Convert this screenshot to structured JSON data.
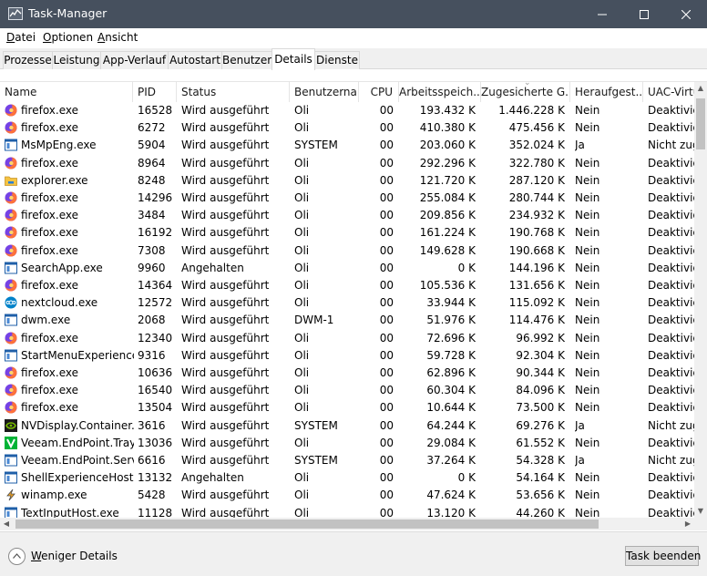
{
  "window": {
    "title": "Task-Manager"
  },
  "menu": [
    "Datei",
    "Optionen",
    "Ansicht"
  ],
  "tabs": [
    {
      "label": "Prozesse",
      "active": false
    },
    {
      "label": "Leistung",
      "active": false
    },
    {
      "label": "App-Verlauf",
      "active": false
    },
    {
      "label": "Autostart",
      "active": false
    },
    {
      "label": "Benutzer",
      "active": false
    },
    {
      "label": "Details",
      "active": true
    },
    {
      "label": "Dienste",
      "active": false
    }
  ],
  "columns": [
    "Name",
    "PID",
    "Status",
    "Benutzerna...",
    "CPU",
    "Arbeitsspeich...",
    "Zugesicherte G...",
    "Heraufgest...",
    "UAC-Virtu"
  ],
  "sorted_column": "Zugesicherte G...",
  "sort_direction": "descending",
  "processes": [
    {
      "icon": "firefox-icon",
      "name": "firefox.exe",
      "pid": "16528",
      "status": "Wird ausgeführt",
      "user": "Oli",
      "cpu": "00",
      "memory": "193.432 K",
      "commit": "1.446.228 K",
      "elevated": "Nein",
      "uac": "Deaktivie"
    },
    {
      "icon": "firefox-icon",
      "name": "firefox.exe",
      "pid": "6272",
      "status": "Wird ausgeführt",
      "user": "Oli",
      "cpu": "00",
      "memory": "410.380 K",
      "commit": "475.456 K",
      "elevated": "Nein",
      "uac": "Deaktivie"
    },
    {
      "icon": "window-app-icon",
      "name": "MsMpEng.exe",
      "pid": "5904",
      "status": "Wird ausgeführt",
      "user": "SYSTEM",
      "cpu": "00",
      "memory": "203.060 K",
      "commit": "352.024 K",
      "elevated": "Ja",
      "uac": "Nicht zug"
    },
    {
      "icon": "firefox-icon",
      "name": "firefox.exe",
      "pid": "8964",
      "status": "Wird ausgeführt",
      "user": "Oli",
      "cpu": "00",
      "memory": "292.296 K",
      "commit": "322.780 K",
      "elevated": "Nein",
      "uac": "Deaktivie"
    },
    {
      "icon": "folder-icon",
      "name": "explorer.exe",
      "pid": "8248",
      "status": "Wird ausgeführt",
      "user": "Oli",
      "cpu": "00",
      "memory": "121.720 K",
      "commit": "287.120 K",
      "elevated": "Nein",
      "uac": "Deaktivie"
    },
    {
      "icon": "firefox-icon",
      "name": "firefox.exe",
      "pid": "14296",
      "status": "Wird ausgeführt",
      "user": "Oli",
      "cpu": "00",
      "memory": "255.084 K",
      "commit": "280.744 K",
      "elevated": "Nein",
      "uac": "Deaktivie"
    },
    {
      "icon": "firefox-icon",
      "name": "firefox.exe",
      "pid": "3484",
      "status": "Wird ausgeführt",
      "user": "Oli",
      "cpu": "00",
      "memory": "209.856 K",
      "commit": "234.932 K",
      "elevated": "Nein",
      "uac": "Deaktivie"
    },
    {
      "icon": "firefox-icon",
      "name": "firefox.exe",
      "pid": "16192",
      "status": "Wird ausgeführt",
      "user": "Oli",
      "cpu": "00",
      "memory": "161.224 K",
      "commit": "190.768 K",
      "elevated": "Nein",
      "uac": "Deaktivie"
    },
    {
      "icon": "firefox-icon",
      "name": "firefox.exe",
      "pid": "7308",
      "status": "Wird ausgeführt",
      "user": "Oli",
      "cpu": "00",
      "memory": "149.628 K",
      "commit": "190.668 K",
      "elevated": "Nein",
      "uac": "Deaktivie"
    },
    {
      "icon": "window-app-icon",
      "name": "SearchApp.exe",
      "pid": "9960",
      "status": "Angehalten",
      "user": "Oli",
      "cpu": "00",
      "memory": "0 K",
      "commit": "144.196 K",
      "elevated": "Nein",
      "uac": "Deaktivie"
    },
    {
      "icon": "firefox-icon",
      "name": "firefox.exe",
      "pid": "14364",
      "status": "Wird ausgeführt",
      "user": "Oli",
      "cpu": "00",
      "memory": "105.536 K",
      "commit": "131.656 K",
      "elevated": "Nein",
      "uac": "Deaktivie"
    },
    {
      "icon": "nextcloud-icon",
      "name": "nextcloud.exe",
      "pid": "12572",
      "status": "Wird ausgeführt",
      "user": "Oli",
      "cpu": "00",
      "memory": "33.944 K",
      "commit": "115.092 K",
      "elevated": "Nein",
      "uac": "Deaktivie"
    },
    {
      "icon": "window-app-icon",
      "name": "dwm.exe",
      "pid": "2068",
      "status": "Wird ausgeführt",
      "user": "DWM-1",
      "cpu": "00",
      "memory": "51.976 K",
      "commit": "114.476 K",
      "elevated": "Nein",
      "uac": "Deaktivie"
    },
    {
      "icon": "firefox-icon",
      "name": "firefox.exe",
      "pid": "12340",
      "status": "Wird ausgeführt",
      "user": "Oli",
      "cpu": "00",
      "memory": "72.696 K",
      "commit": "96.992 K",
      "elevated": "Nein",
      "uac": "Deaktivie"
    },
    {
      "icon": "window-app-icon",
      "name": "StartMenuExperience...",
      "pid": "9316",
      "status": "Wird ausgeführt",
      "user": "Oli",
      "cpu": "00",
      "memory": "59.728 K",
      "commit": "92.304 K",
      "elevated": "Nein",
      "uac": "Deaktivie"
    },
    {
      "icon": "firefox-icon",
      "name": "firefox.exe",
      "pid": "10636",
      "status": "Wird ausgeführt",
      "user": "Oli",
      "cpu": "00",
      "memory": "62.896 K",
      "commit": "90.344 K",
      "elevated": "Nein",
      "uac": "Deaktivie"
    },
    {
      "icon": "firefox-icon",
      "name": "firefox.exe",
      "pid": "16540",
      "status": "Wird ausgeführt",
      "user": "Oli",
      "cpu": "00",
      "memory": "60.304 K",
      "commit": "84.096 K",
      "elevated": "Nein",
      "uac": "Deaktivie"
    },
    {
      "icon": "firefox-icon",
      "name": "firefox.exe",
      "pid": "13504",
      "status": "Wird ausgeführt",
      "user": "Oli",
      "cpu": "00",
      "memory": "10.644 K",
      "commit": "73.500 K",
      "elevated": "Nein",
      "uac": "Deaktivie"
    },
    {
      "icon": "nvidia-icon",
      "name": "NVDisplay.Container....",
      "pid": "3616",
      "status": "Wird ausgeführt",
      "user": "SYSTEM",
      "cpu": "00",
      "memory": "64.244 K",
      "commit": "69.276 K",
      "elevated": "Ja",
      "uac": "Nicht zug"
    },
    {
      "icon": "veeam-icon",
      "name": "Veeam.EndPoint.Tray....",
      "pid": "13036",
      "status": "Wird ausgeführt",
      "user": "Oli",
      "cpu": "00",
      "memory": "29.084 K",
      "commit": "61.552 K",
      "elevated": "Nein",
      "uac": "Deaktivie"
    },
    {
      "icon": "window-app-icon",
      "name": "Veeam.EndPoint.Servi...",
      "pid": "6616",
      "status": "Wird ausgeführt",
      "user": "SYSTEM",
      "cpu": "00",
      "memory": "37.264 K",
      "commit": "54.328 K",
      "elevated": "Ja",
      "uac": "Nicht zug"
    },
    {
      "icon": "window-app-icon",
      "name": "ShellExperienceHost....",
      "pid": "13132",
      "status": "Angehalten",
      "user": "Oli",
      "cpu": "00",
      "memory": "0 K",
      "commit": "54.164 K",
      "elevated": "Nein",
      "uac": "Deaktivie"
    },
    {
      "icon": "winamp-icon",
      "name": "winamp.exe",
      "pid": "5428",
      "status": "Wird ausgeführt",
      "user": "Oli",
      "cpu": "00",
      "memory": "47.624 K",
      "commit": "53.656 K",
      "elevated": "Nein",
      "uac": "Deaktivie"
    },
    {
      "icon": "window-app-icon",
      "name": "TextInputHost.exe",
      "pid": "11128",
      "status": "Wird ausgeführt",
      "user": "Oli",
      "cpu": "00",
      "memory": "13.120 K",
      "commit": "44.260 K",
      "elevated": "Nein",
      "uac": "Deaktivie"
    }
  ],
  "footer": {
    "fewer_details": "Weniger Details",
    "end_task": "Task beenden"
  },
  "colors": {
    "titlebar": "#46505e",
    "firefox_orange": "#ff7139",
    "firefox_purple": "#7542e5",
    "nextcloud_blue": "#0082c9",
    "nvidia_green": "#76b900",
    "veeam_green": "#00b336",
    "app_blue": "#1f5fa8",
    "folder_yellow": "#f5c342"
  }
}
